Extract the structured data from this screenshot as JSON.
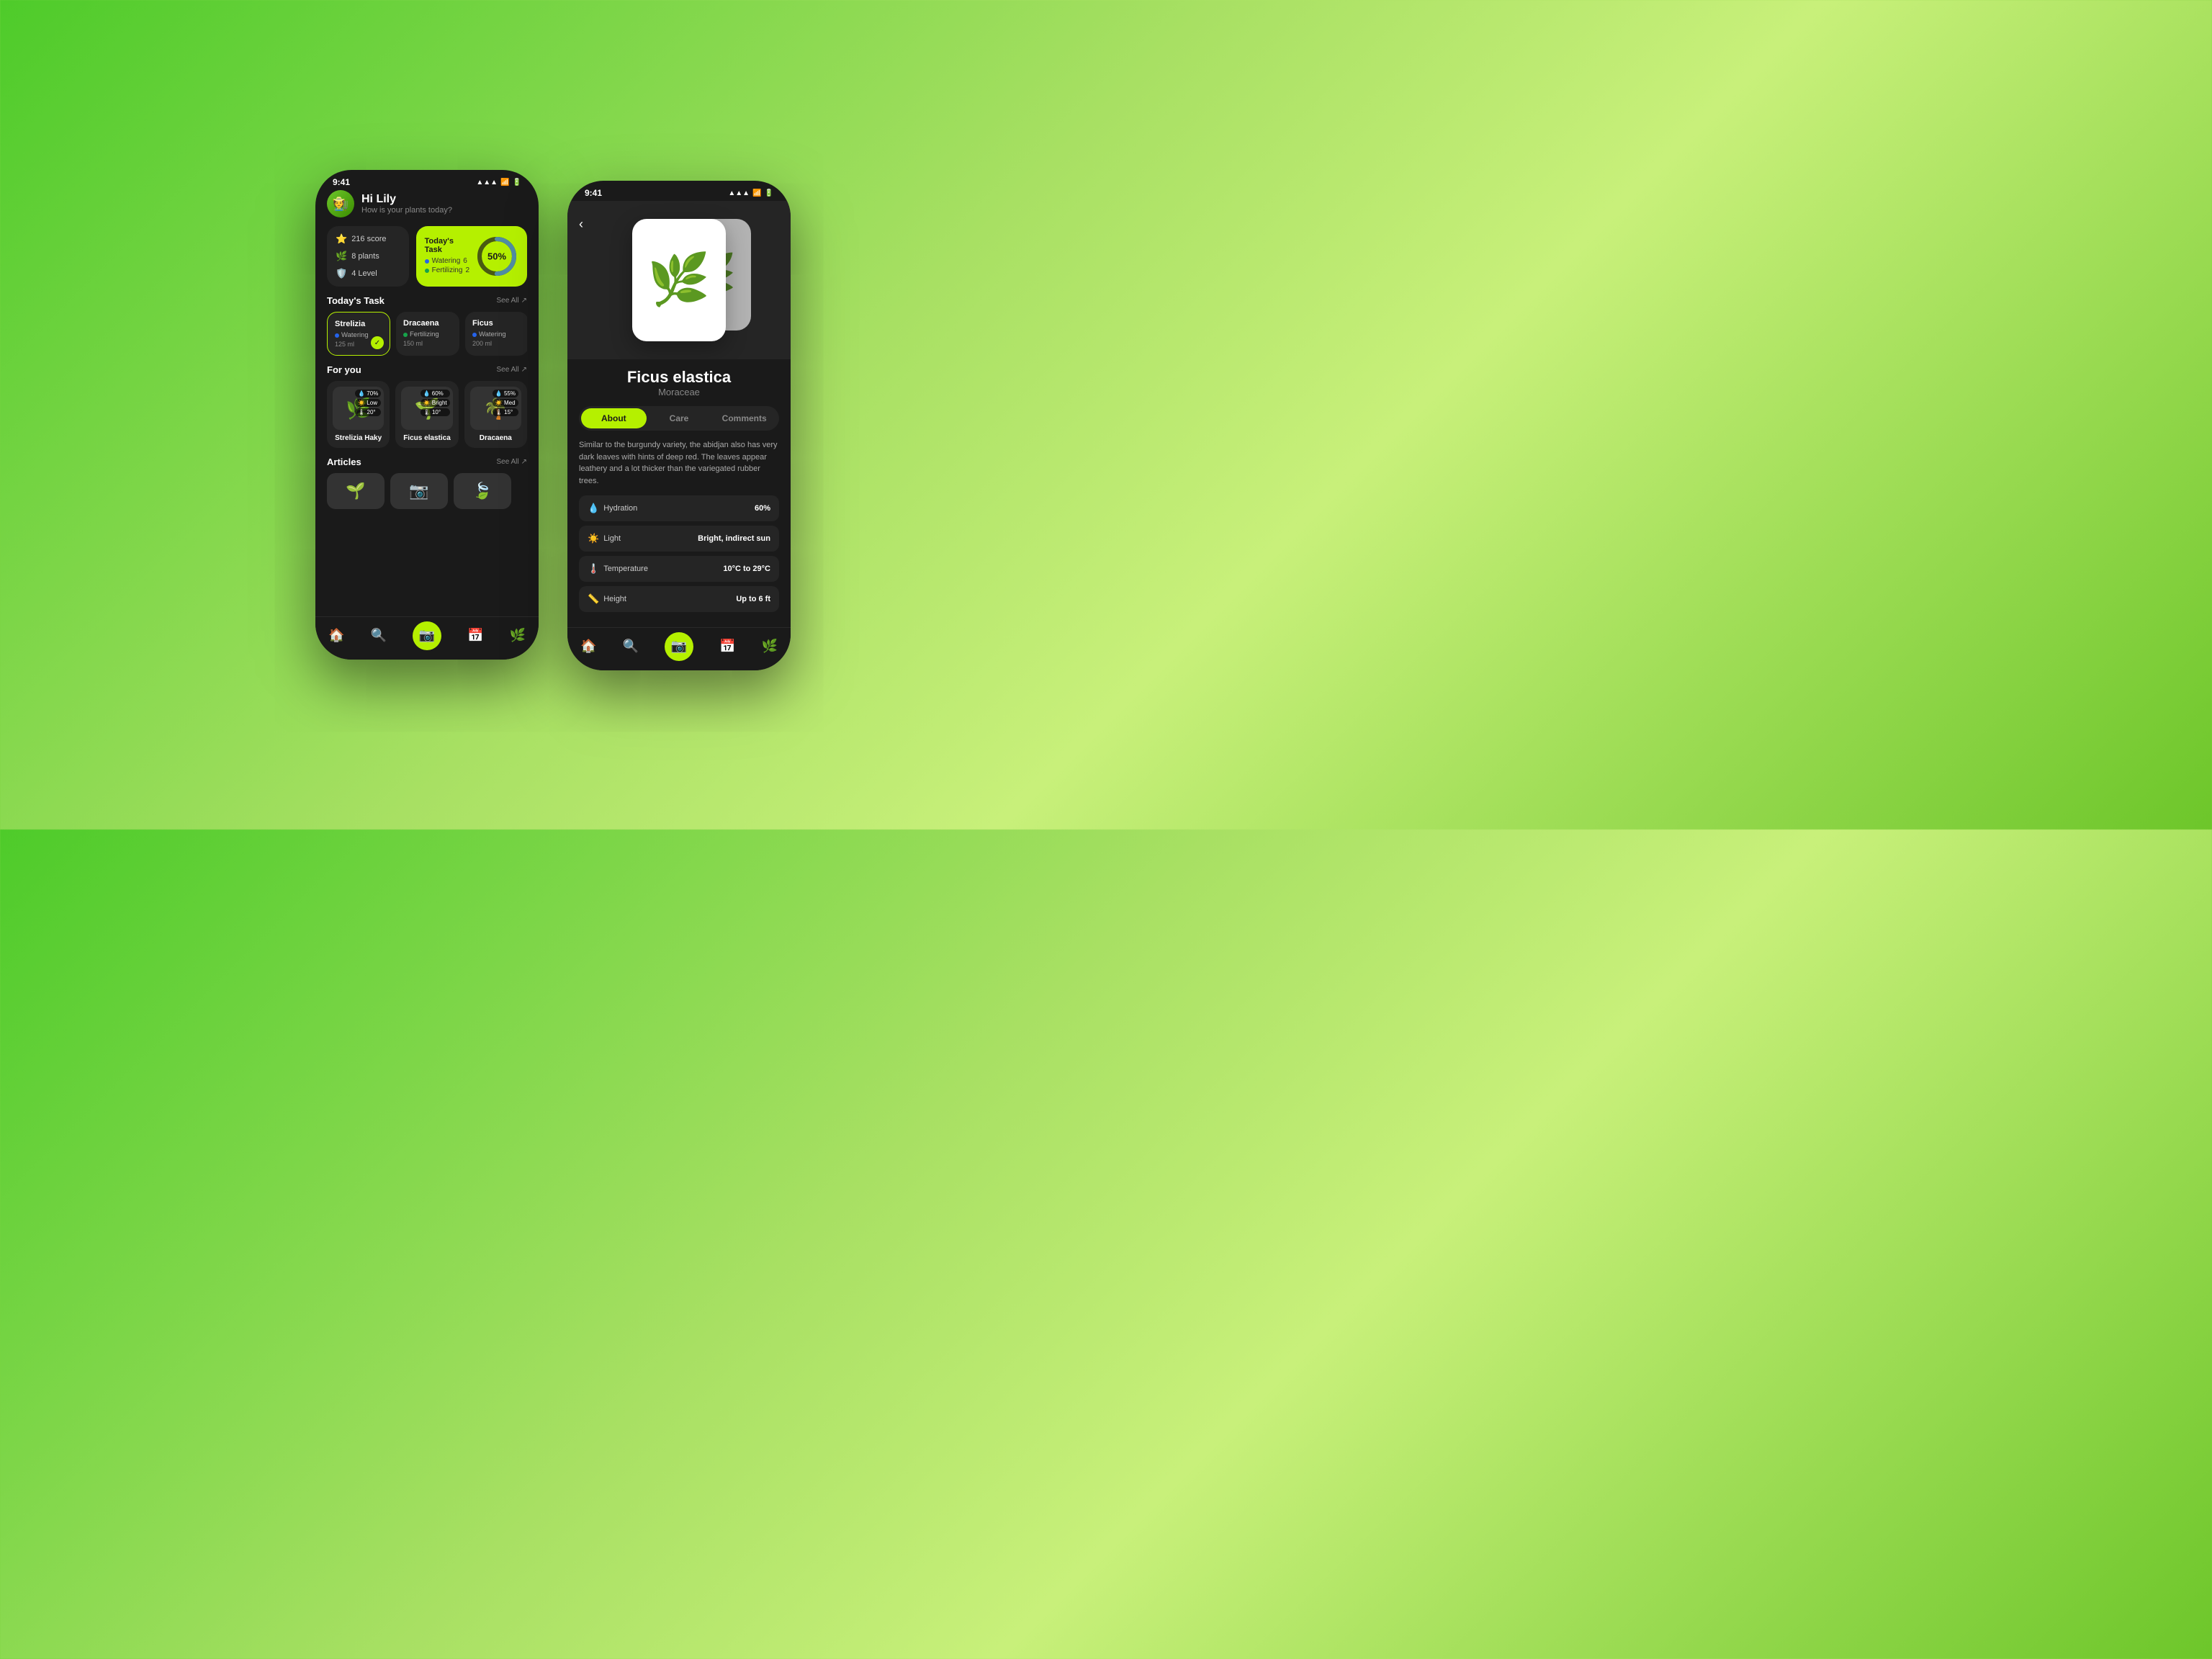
{
  "background": "#4ecb2a",
  "phone1": {
    "status": {
      "time": "9:41",
      "signal": "▲▲▲",
      "wifi": "wifi",
      "battery": "battery"
    },
    "header": {
      "greeting": "Hi Lily",
      "subtitle": "How is your plants today?",
      "avatar_emoji": "🧑‍🌾"
    },
    "stats": {
      "score": "216 score",
      "plants": "8 plants",
      "level": "4 Level"
    },
    "todays_task_card": {
      "title": "Today's Task",
      "watering_label": "Watering",
      "watering_count": "6",
      "fertilizing_label": "Fertilizing",
      "fertilizing_count": "2",
      "percentage": "50%"
    },
    "todays_task_section": {
      "title": "Today's Task",
      "see_all": "See All"
    },
    "task_plants": [
      {
        "name": "Strelizia",
        "type": "Watering",
        "type_color": "#2563eb",
        "amount": "125 ml",
        "selected": true,
        "done": true
      },
      {
        "name": "Dracaena",
        "type": "Fertilizing",
        "type_color": "#16a34a",
        "amount": "150 ml",
        "selected": false,
        "done": false
      },
      {
        "name": "Ficus",
        "type": "Watering",
        "type_color": "#2563eb",
        "amount": "200 ml",
        "selected": false,
        "done": false
      }
    ],
    "for_you": {
      "title": "For you",
      "see_all": "See All",
      "plants": [
        {
          "name": "Strelizia Haky",
          "emoji": "🌿",
          "humidity": "70%",
          "light": "Low",
          "temp": "20°"
        },
        {
          "name": "Ficus elastica",
          "emoji": "🌱",
          "humidity": "60%",
          "light": "Bright",
          "temp": "10°"
        },
        {
          "name": "Dracaena",
          "emoji": "🌴",
          "humidity": "55%",
          "light": "Med",
          "temp": "15°"
        }
      ]
    },
    "articles": {
      "title": "Articles",
      "see_all": "See All"
    },
    "nav": {
      "home": "🏠",
      "search": "🔍",
      "camera": "📷",
      "calendar": "📅",
      "plants": "🌿"
    }
  },
  "phone2": {
    "status": {
      "time": "9:41"
    },
    "plant": {
      "name": "Ficus elastica",
      "family": "Moraceae",
      "emoji": "🌿"
    },
    "tabs": [
      {
        "label": "About",
        "active": true
      },
      {
        "label": "Care",
        "active": false
      },
      {
        "label": "Comments",
        "active": false
      }
    ],
    "about_text": "Similar to the burgundy variety, the abidjan also has very dark leaves with hints of deep red. The leaves appear leathery and a lot thicker than the variegated rubber trees.",
    "info_rows": [
      {
        "icon": "💧",
        "label": "Hydration",
        "value": "60%"
      },
      {
        "icon": "☀️",
        "label": "Light",
        "value": "Bright, indirect sun"
      },
      {
        "icon": "🌡️",
        "label": "Temperature",
        "value": "10°C to 29°C"
      },
      {
        "icon": "📏",
        "label": "Height",
        "value": "Up to 6 ft"
      }
    ]
  }
}
